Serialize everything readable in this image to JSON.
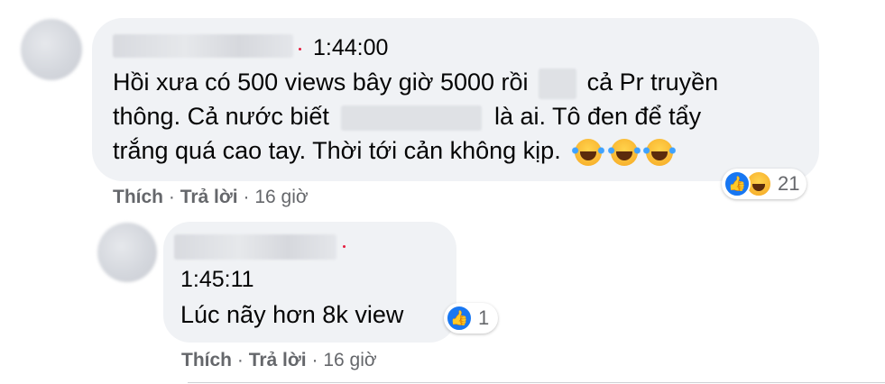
{
  "comment": {
    "time": "1:44:00",
    "line1": "Hồi xưa có 500 views bây giờ 5000 rồi",
    "line1_after": "cả Pr truyền",
    "line2_before": "thông. Cả nước biết",
    "line2_after": "là ai. Tô đen để tẩy",
    "line3": "trắng quá cao tay. Thời tới cản không kịp.",
    "actions": {
      "like": "Thích",
      "reply": "Trả lời",
      "sep": "·",
      "age": "16 giờ"
    },
    "reactions": {
      "count": "21",
      "icons": [
        "like-icon",
        "haha-icon"
      ]
    }
  },
  "reply": {
    "time": "1:45:11",
    "text": "Lúc nãy hơn 8k view",
    "actions": {
      "like": "Thích",
      "reply": "Trả lời",
      "sep": "·",
      "age": "16 giờ"
    },
    "reactions": {
      "count": "1",
      "icons": [
        "like-icon"
      ]
    }
  },
  "colors": {
    "bubble": "#f0f2f5",
    "like_blue": "#1877f2",
    "meta_gray": "#65676b",
    "text": "#050505"
  }
}
